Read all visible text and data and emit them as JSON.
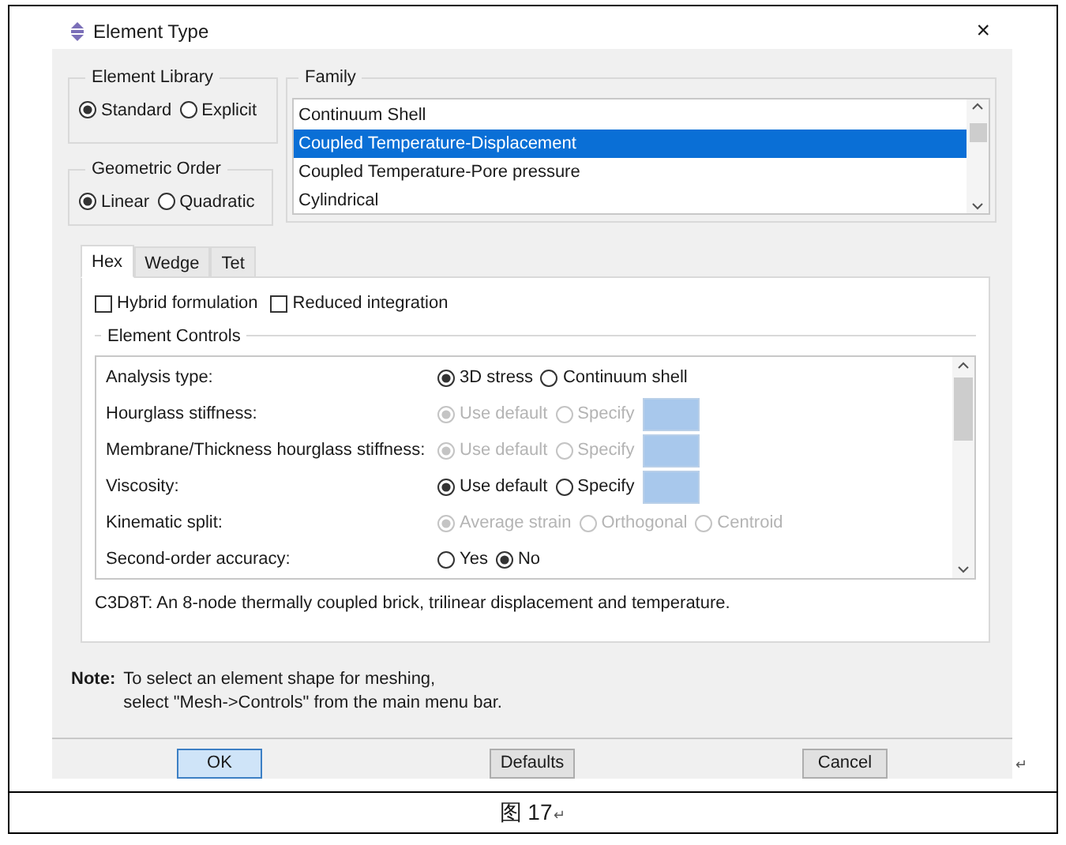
{
  "dialog": {
    "title": "Element Type",
    "close": "×"
  },
  "element_library": {
    "title": "Element Library",
    "options": [
      {
        "label": "Standard",
        "selected": true
      },
      {
        "label": "Explicit",
        "selected": false
      }
    ]
  },
  "geometric_order": {
    "title": "Geometric Order",
    "options": [
      {
        "label": "Linear",
        "selected": true
      },
      {
        "label": "Quadratic",
        "selected": false
      }
    ]
  },
  "family": {
    "title": "Family",
    "items": [
      {
        "label": "Continuum Shell",
        "selected": false
      },
      {
        "label": "Coupled Temperature-Displacement",
        "selected": true
      },
      {
        "label": "Coupled Temperature-Pore pressure",
        "selected": false
      },
      {
        "label": "Cylindrical",
        "selected": false
      }
    ]
  },
  "tabs": [
    {
      "label": "Hex",
      "selected": true
    },
    {
      "label": "Wedge",
      "selected": false
    },
    {
      "label": "Tet",
      "selected": false
    }
  ],
  "checkboxes": [
    {
      "label": "Hybrid formulation",
      "checked": false
    },
    {
      "label": "Reduced integration",
      "checked": false
    }
  ],
  "element_controls": {
    "title": "Element Controls",
    "rows": [
      {
        "label": "Analysis type:",
        "disabled": false,
        "field": false,
        "options": [
          {
            "label": "3D stress",
            "selected": true
          },
          {
            "label": "Continuum shell",
            "selected": false
          }
        ]
      },
      {
        "label": "Hourglass stiffness:",
        "disabled": true,
        "field": true,
        "options": [
          {
            "label": "Use default",
            "selected": true
          },
          {
            "label": "Specify",
            "selected": false
          }
        ]
      },
      {
        "label": "Membrane/Thickness hourglass stiffness:",
        "disabled": true,
        "field": true,
        "options": [
          {
            "label": "Use default",
            "selected": true
          },
          {
            "label": "Specify",
            "selected": false
          }
        ]
      },
      {
        "label": "Viscosity:",
        "disabled": false,
        "field": true,
        "options": [
          {
            "label": "Use default",
            "selected": true
          },
          {
            "label": "Specify",
            "selected": false
          }
        ]
      },
      {
        "label": "Kinematic split:",
        "disabled": true,
        "field": false,
        "options": [
          {
            "label": "Average strain",
            "selected": true
          },
          {
            "label": "Orthogonal",
            "selected": false
          },
          {
            "label": "Centroid",
            "selected": false
          }
        ]
      },
      {
        "label": "Second-order accuracy:",
        "disabled": false,
        "field": false,
        "options": [
          {
            "label": "Yes",
            "selected": false
          },
          {
            "label": "No",
            "selected": true
          }
        ]
      }
    ]
  },
  "description": "C3D8T:  An 8-node thermally coupled brick, trilinear displacement and temperature.",
  "note": {
    "label": "Note:",
    "lines": [
      "To select an element shape for meshing,",
      "select \"Mesh->Controls\" from the main menu bar."
    ]
  },
  "buttons": [
    {
      "label": "OK",
      "focused": true
    },
    {
      "label": "Defaults",
      "focused": false
    },
    {
      "label": "Cancel",
      "focused": false
    }
  ],
  "paragraph_mark": "↵",
  "caption": "图 17",
  "caption_mark": "↵"
}
